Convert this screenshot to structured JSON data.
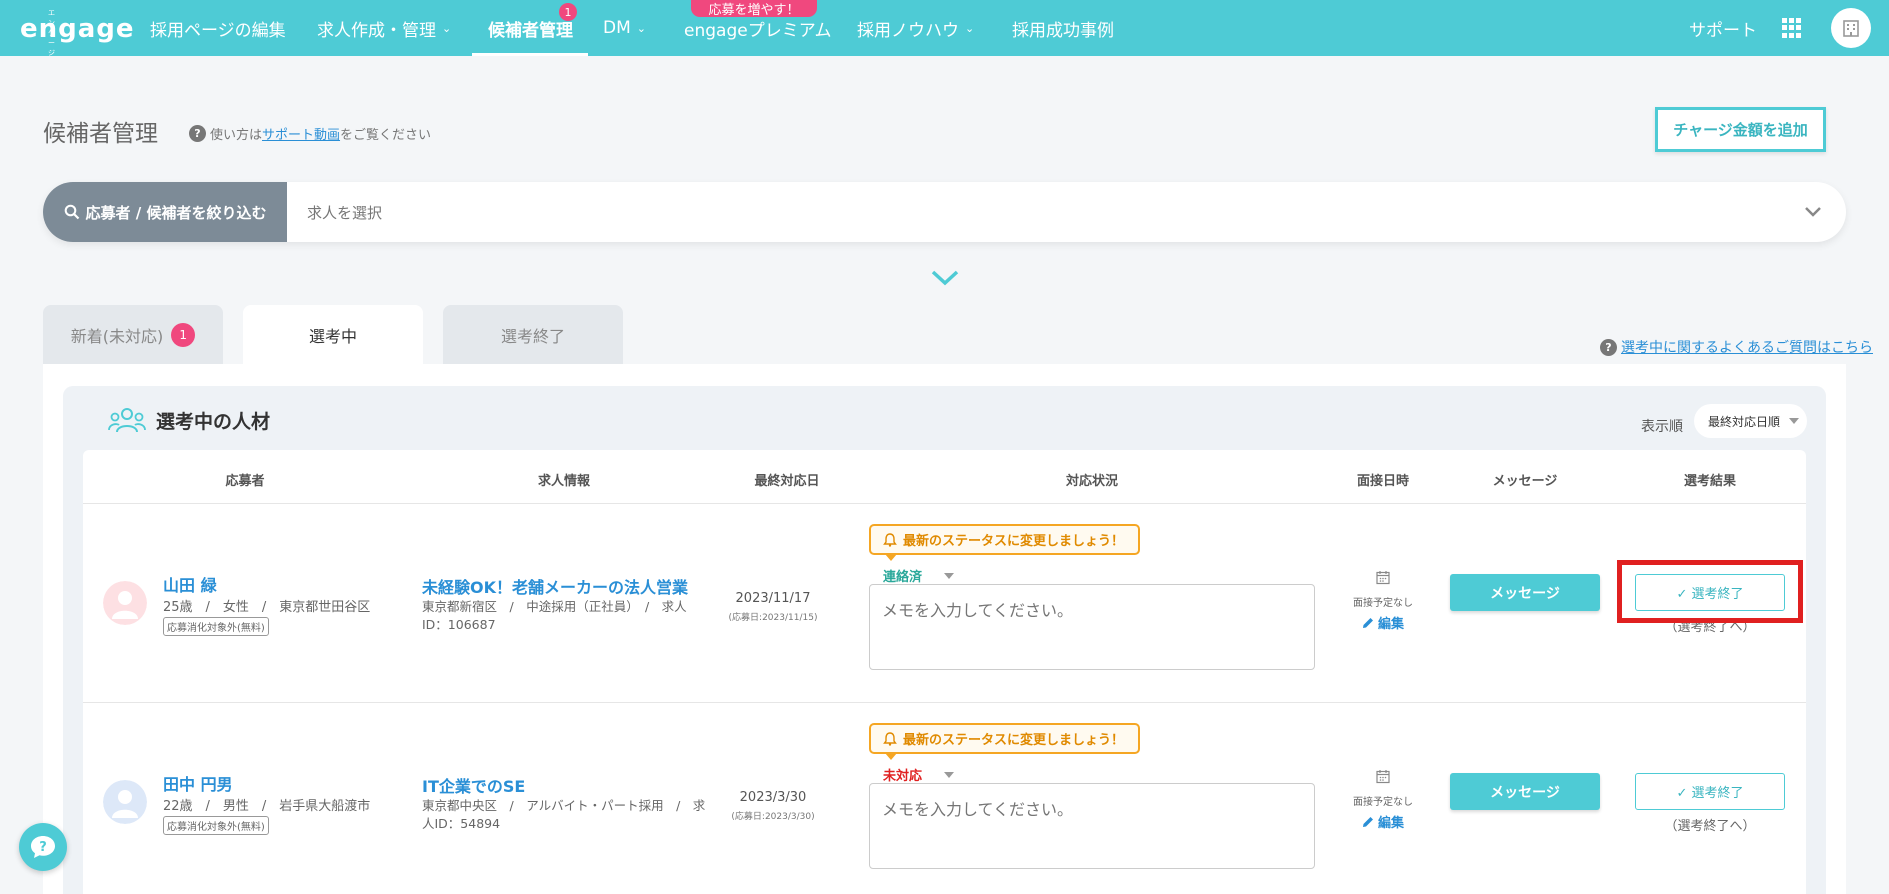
{
  "nav": {
    "logo_kana": "エンゲージ",
    "logo_text": "engage",
    "items": [
      {
        "label": "採用ページの編集"
      },
      {
        "label": "求人作成・管理"
      },
      {
        "label": "候補者管理",
        "badge": "1"
      },
      {
        "label": "DM"
      },
      {
        "label": "engageプレミアム",
        "promo": "応募を増やす！"
      },
      {
        "label": "採用ノウハウ"
      },
      {
        "label": "採用成功事例"
      }
    ],
    "support": "サポート"
  },
  "header": {
    "title": "候補者管理",
    "help_prefix": "使い方は",
    "help_link": "サポート動画",
    "help_suffix": "をご覧ください",
    "charge_button": "チャージ金額を追加"
  },
  "filter": {
    "button": "応募者 / 候補者を絞り込む",
    "select_placeholder": "求人を選択"
  },
  "tabs": [
    {
      "label": "新着(未対応)",
      "badge": "1"
    },
    {
      "label": "選考中"
    },
    {
      "label": "選考終了"
    }
  ],
  "faq_link": "選考中に関するよくあるご質問はこちら",
  "section": {
    "title": "選考中の人材",
    "sort_label": "表示順",
    "sort_value": "最終対応日順"
  },
  "columns": [
    "応募者",
    "求人情報",
    "最終対応日",
    "対応状況",
    "面接日時",
    "メッセージ",
    "選考結果"
  ],
  "candidates": [
    {
      "name": "山田 緑",
      "meta": "25歳　/　女性　/　東京都世田谷区",
      "tag": "応募消化対象外(無料)",
      "job_title": "未経験OK！老舗メーカーの法人営業",
      "job_meta": "東京都新宿区　/　中途採用（正社員）　/　求人ID：106687",
      "last_date": "2023/11/17",
      "applied_date": "(応募日:2023/11/15)",
      "alert": "最新のステータスに変更しましょう！",
      "status": "連絡済",
      "status_color": "#2aa89a",
      "memo_placeholder": "メモを入力してください。",
      "interview": "面接予定なし",
      "edit": "編集",
      "message_button": "メッセージ",
      "end_button": "✓ 選考終了",
      "end_sub": "（選考終了へ）"
    },
    {
      "name": "田中 円男",
      "meta": "22歳　/　男性　/　岩手県大船渡市",
      "tag": "応募消化対象外(無料)",
      "job_title": "IT企業でのSE",
      "job_meta": "東京都中央区　/　アルバイト・パート採用　/　求人ID：54894",
      "last_date": "2023/3/30",
      "applied_date": "(応募日:2023/3/30)",
      "alert": "最新のステータスに変更しましょう！",
      "status": "未対応",
      "status_color": "#e02020",
      "memo_placeholder": "メモを入力してください。",
      "interview": "面接予定なし",
      "edit": "編集",
      "message_button": "メッセージ",
      "end_button": "✓ 選考終了",
      "end_sub": "（選考終了へ）"
    }
  ]
}
